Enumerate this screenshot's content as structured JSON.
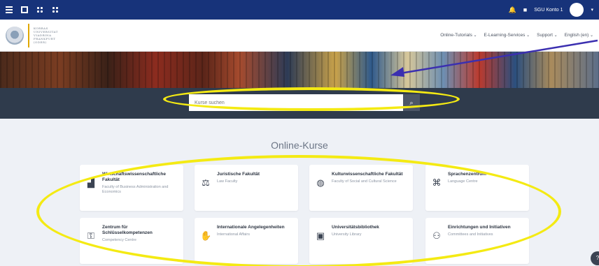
{
  "topbar": {
    "user_label": "SGU Konto 1"
  },
  "logo": {
    "line1": "KORRAS",
    "line2": "UNIVERSITAT",
    "line3": "VIADRINA",
    "line4": "FRANKFURT",
    "line5": "(ODER)"
  },
  "menu": [
    "Online-Tutorials",
    "E-Learning-Services",
    "Support",
    "English (en)"
  ],
  "search": {
    "placeholder": "Kurse suchen"
  },
  "section_title": "Online-Kurse",
  "cards": [
    {
      "title": "Wirtschaftswissenschaftliche Fakultät",
      "subtitle": "Faculty of Business Administration and Economics",
      "icon": "chart-icon"
    },
    {
      "title": "Juristische Fakultät",
      "subtitle": "Law Faculty",
      "icon": "scales-icon"
    },
    {
      "title": "Kulturwissenschaftliche Fakultät",
      "subtitle": "Faculty of Social and Cultural Science",
      "icon": "globe-icon"
    },
    {
      "title": "Sprachenzentrum",
      "subtitle": "Language Centre",
      "icon": "language-icon"
    },
    {
      "title": "Zentrum für Schlüsselkompetenzen",
      "subtitle": "Competency Centre",
      "icon": "key-icon"
    },
    {
      "title": "Internationale Angelegenheiten",
      "subtitle": "International Affairs",
      "icon": "handshake-icon"
    },
    {
      "title": "Universitätsbibliothek",
      "subtitle": "University Library",
      "icon": "book-icon"
    },
    {
      "title": "Einrichtungen und Initiativen",
      "subtitle": "Committees and Initiatives",
      "icon": "people-icon"
    }
  ],
  "colors": {
    "topbar": "#17337a",
    "highlight": "#f4ea13",
    "arrow": "#3b2fb0"
  }
}
